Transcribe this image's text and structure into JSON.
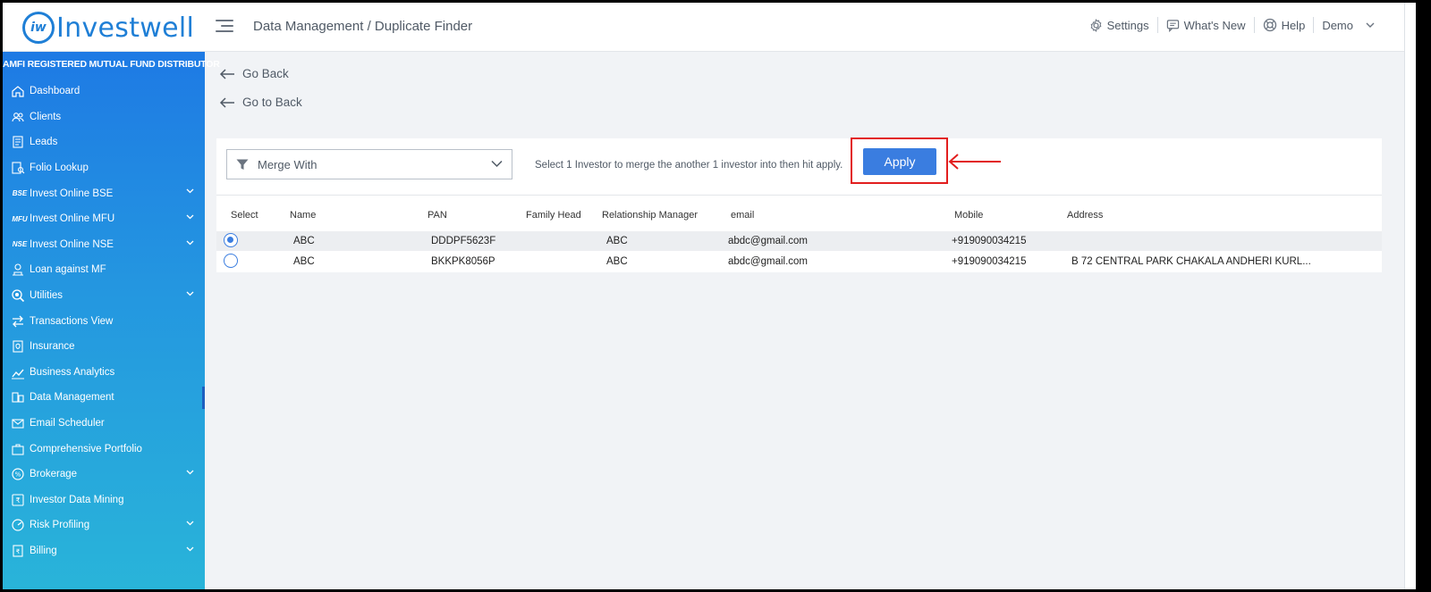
{
  "header": {
    "logo_mark": "iw",
    "logo_text": "Investwell",
    "breadcrumb": "Data Management / Duplicate Finder",
    "settings": "Settings",
    "whats_new": "What's New",
    "help": "Help",
    "user": "Demo"
  },
  "sidebar": {
    "distributor": "AMFI REGISTERED MUTUAL FUND DISTRIBUTOR",
    "items": [
      {
        "label": "Dashboard",
        "icon": "home-icon"
      },
      {
        "label": "Clients",
        "icon": "users-icon"
      },
      {
        "label": "Leads",
        "icon": "leads-icon"
      },
      {
        "label": "Folio Lookup",
        "icon": "folio-lookup-icon"
      },
      {
        "label": "Invest Online BSE",
        "icon_text": "BSE",
        "expandable": true
      },
      {
        "label": "Invest Online MFU",
        "icon_text": "MFU",
        "expandable": true
      },
      {
        "label": "Invest Online NSE",
        "icon_text": "NSE",
        "expandable": true
      },
      {
        "label": "Loan against MF",
        "icon": "loan-icon"
      },
      {
        "label": "Utilities",
        "icon": "utilities-icon",
        "expandable": true
      },
      {
        "label": "Transactions View",
        "icon": "transactions-icon"
      },
      {
        "label": "Insurance",
        "icon": "insurance-icon"
      },
      {
        "label": "Business Analytics",
        "icon": "analytics-icon"
      },
      {
        "label": "Data Management",
        "icon": "data-management-icon",
        "active": true
      },
      {
        "label": "Email Scheduler",
        "icon": "email-icon"
      },
      {
        "label": "Comprehensive Portfolio",
        "icon": "portfolio-icon"
      },
      {
        "label": "Brokerage",
        "icon": "brokerage-icon",
        "expandable": true
      },
      {
        "label": "Investor Data Mining",
        "icon": "data-mining-icon"
      },
      {
        "label": "Risk Profiling",
        "icon": "risk-icon",
        "expandable": true
      },
      {
        "label": "Billing",
        "icon": "billing-icon",
        "expandable": true
      }
    ]
  },
  "content": {
    "go_back": "Go Back",
    "go_to_back": "Go to Back",
    "merge_select": "Merge With",
    "hint": "Select 1 Investor to merge the another 1 investor into then hit apply.",
    "apply": "Apply",
    "columns": [
      "Select",
      "Name",
      "PAN",
      "Family Head",
      "Relationship Manager",
      "email",
      "Mobile",
      "Address"
    ],
    "rows": [
      {
        "selected": true,
        "name": "ABC",
        "pan": "DDDPF5623F",
        "family_head": "",
        "rm": "ABC",
        "email": "abdc@gmail.com",
        "mobile": "+919090034215",
        "address": ""
      },
      {
        "selected": false,
        "name": "ABC",
        "pan": "BKKPK8056P",
        "family_head": "",
        "rm": "ABC",
        "email": "abdc@gmail.com",
        "mobile": "+919090034215",
        "address": "B 72 CENTRAL PARK CHAKALA ANDHERI KURL..."
      }
    ]
  },
  "colors": {
    "accent": "#3a7de0",
    "annotation": "#e21e1e",
    "brand": "#1f7fd6"
  }
}
